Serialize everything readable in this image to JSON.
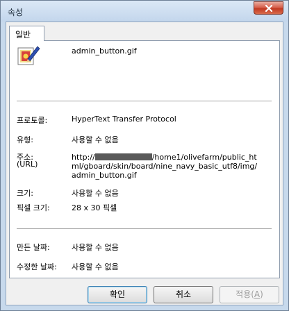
{
  "window": {
    "title": "속성"
  },
  "tabs": [
    {
      "label": "일반"
    }
  ],
  "file": {
    "name": "admin_button.gif",
    "icon": "gif-image-file-icon"
  },
  "properties": {
    "protocol": {
      "label": "프로토콜:",
      "value": "HyperText Transfer Protocol"
    },
    "type": {
      "label": "유형:",
      "value": "사용할 수 없음"
    },
    "address": {
      "label": "주소:",
      "label2": "(URL)",
      "prefix": "http://",
      "line1_rest": "/home1/olivefarm/public_ht",
      "line2": "ml/gboard/skin/board/nine_navy_basic_utf8/img/",
      "line3": "admin_button.gif"
    },
    "size": {
      "label": "크기:",
      "value": "사용할 수 없음"
    },
    "dimensions": {
      "label": "픽셀 크기:",
      "value": "28 x 30 픽셀"
    },
    "created": {
      "label": "만든 날짜:",
      "value": "사용할 수 없음"
    },
    "modified": {
      "label": "수정한 날짜:",
      "value": "사용할 수 없음"
    }
  },
  "buttons": {
    "ok": "확인",
    "cancel": "취소",
    "apply_prefix": "적용(",
    "apply_key": "A",
    "apply_suffix": ")"
  },
  "colors": {
    "titlebar": "#c7d9ec",
    "close": "#c23a23",
    "default_button_border": "#3c7fb1"
  }
}
